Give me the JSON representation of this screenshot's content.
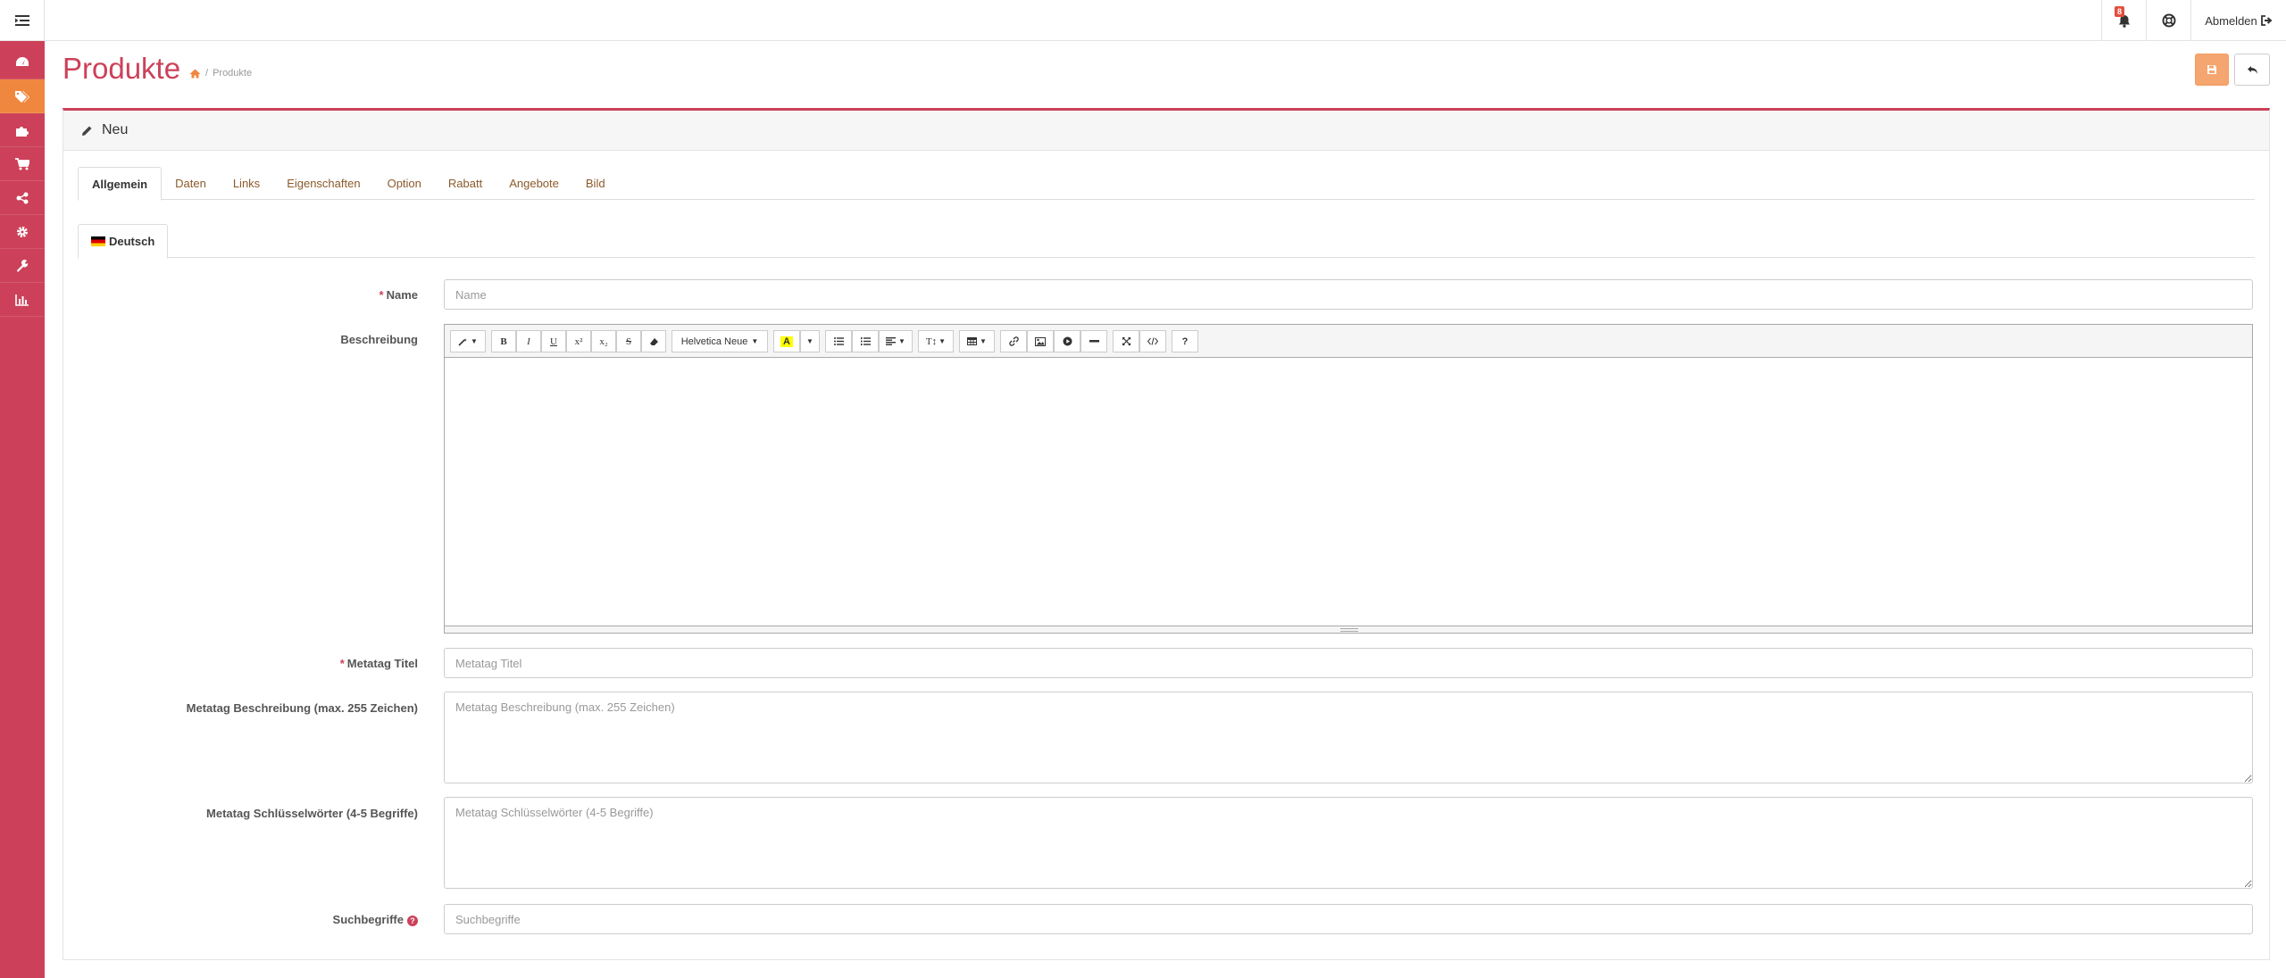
{
  "header": {
    "notification_count": "8",
    "logout_label": "Abmelden"
  },
  "sidebar": {
    "items": [
      {
        "icon": "dashboard-icon",
        "active": false
      },
      {
        "icon": "tags-icon",
        "active": true
      },
      {
        "icon": "puzzle-icon",
        "active": false
      },
      {
        "icon": "shopping-cart-icon",
        "active": false
      },
      {
        "icon": "share-icon",
        "active": false
      },
      {
        "icon": "gear-icon",
        "active": false
      },
      {
        "icon": "wrench-icon",
        "active": false
      },
      {
        "icon": "bar-chart-icon",
        "active": false
      }
    ]
  },
  "page": {
    "title": "Produkte",
    "breadcrumb_current": "Produkte"
  },
  "panel": {
    "title": "Neu"
  },
  "tabs": [
    {
      "label": "Allgemein",
      "active": true
    },
    {
      "label": "Daten"
    },
    {
      "label": "Links"
    },
    {
      "label": "Eigenschaften"
    },
    {
      "label": "Option"
    },
    {
      "label": "Rabatt"
    },
    {
      "label": "Angebote"
    },
    {
      "label": "Bild"
    }
  ],
  "language_tab": {
    "label": "Deutsch"
  },
  "form": {
    "name": {
      "label": "Name",
      "placeholder": "Name",
      "value": ""
    },
    "description": {
      "label": "Beschreibung"
    },
    "editor": {
      "font_name": "Helvetica Neue"
    },
    "meta_title": {
      "label": "Metatag Titel",
      "placeholder": "Metatag Titel",
      "value": ""
    },
    "meta_description": {
      "label": "Metatag Beschreibung (max. 255 Zeichen)",
      "placeholder": "Metatag Beschreibung (max. 255 Zeichen)",
      "value": ""
    },
    "meta_keywords": {
      "label": "Metatag Schlüsselwörter (4-5 Begriffe)",
      "placeholder": "Metatag Schlüsselwörter (4-5 Begriffe)",
      "value": ""
    },
    "search_terms": {
      "label": "Suchbegriffe",
      "placeholder": "Suchbegriffe",
      "value": ""
    }
  },
  "colors": {
    "brand": "#cc4159",
    "accent": "#f0873f",
    "link": "#8b5a2b"
  }
}
